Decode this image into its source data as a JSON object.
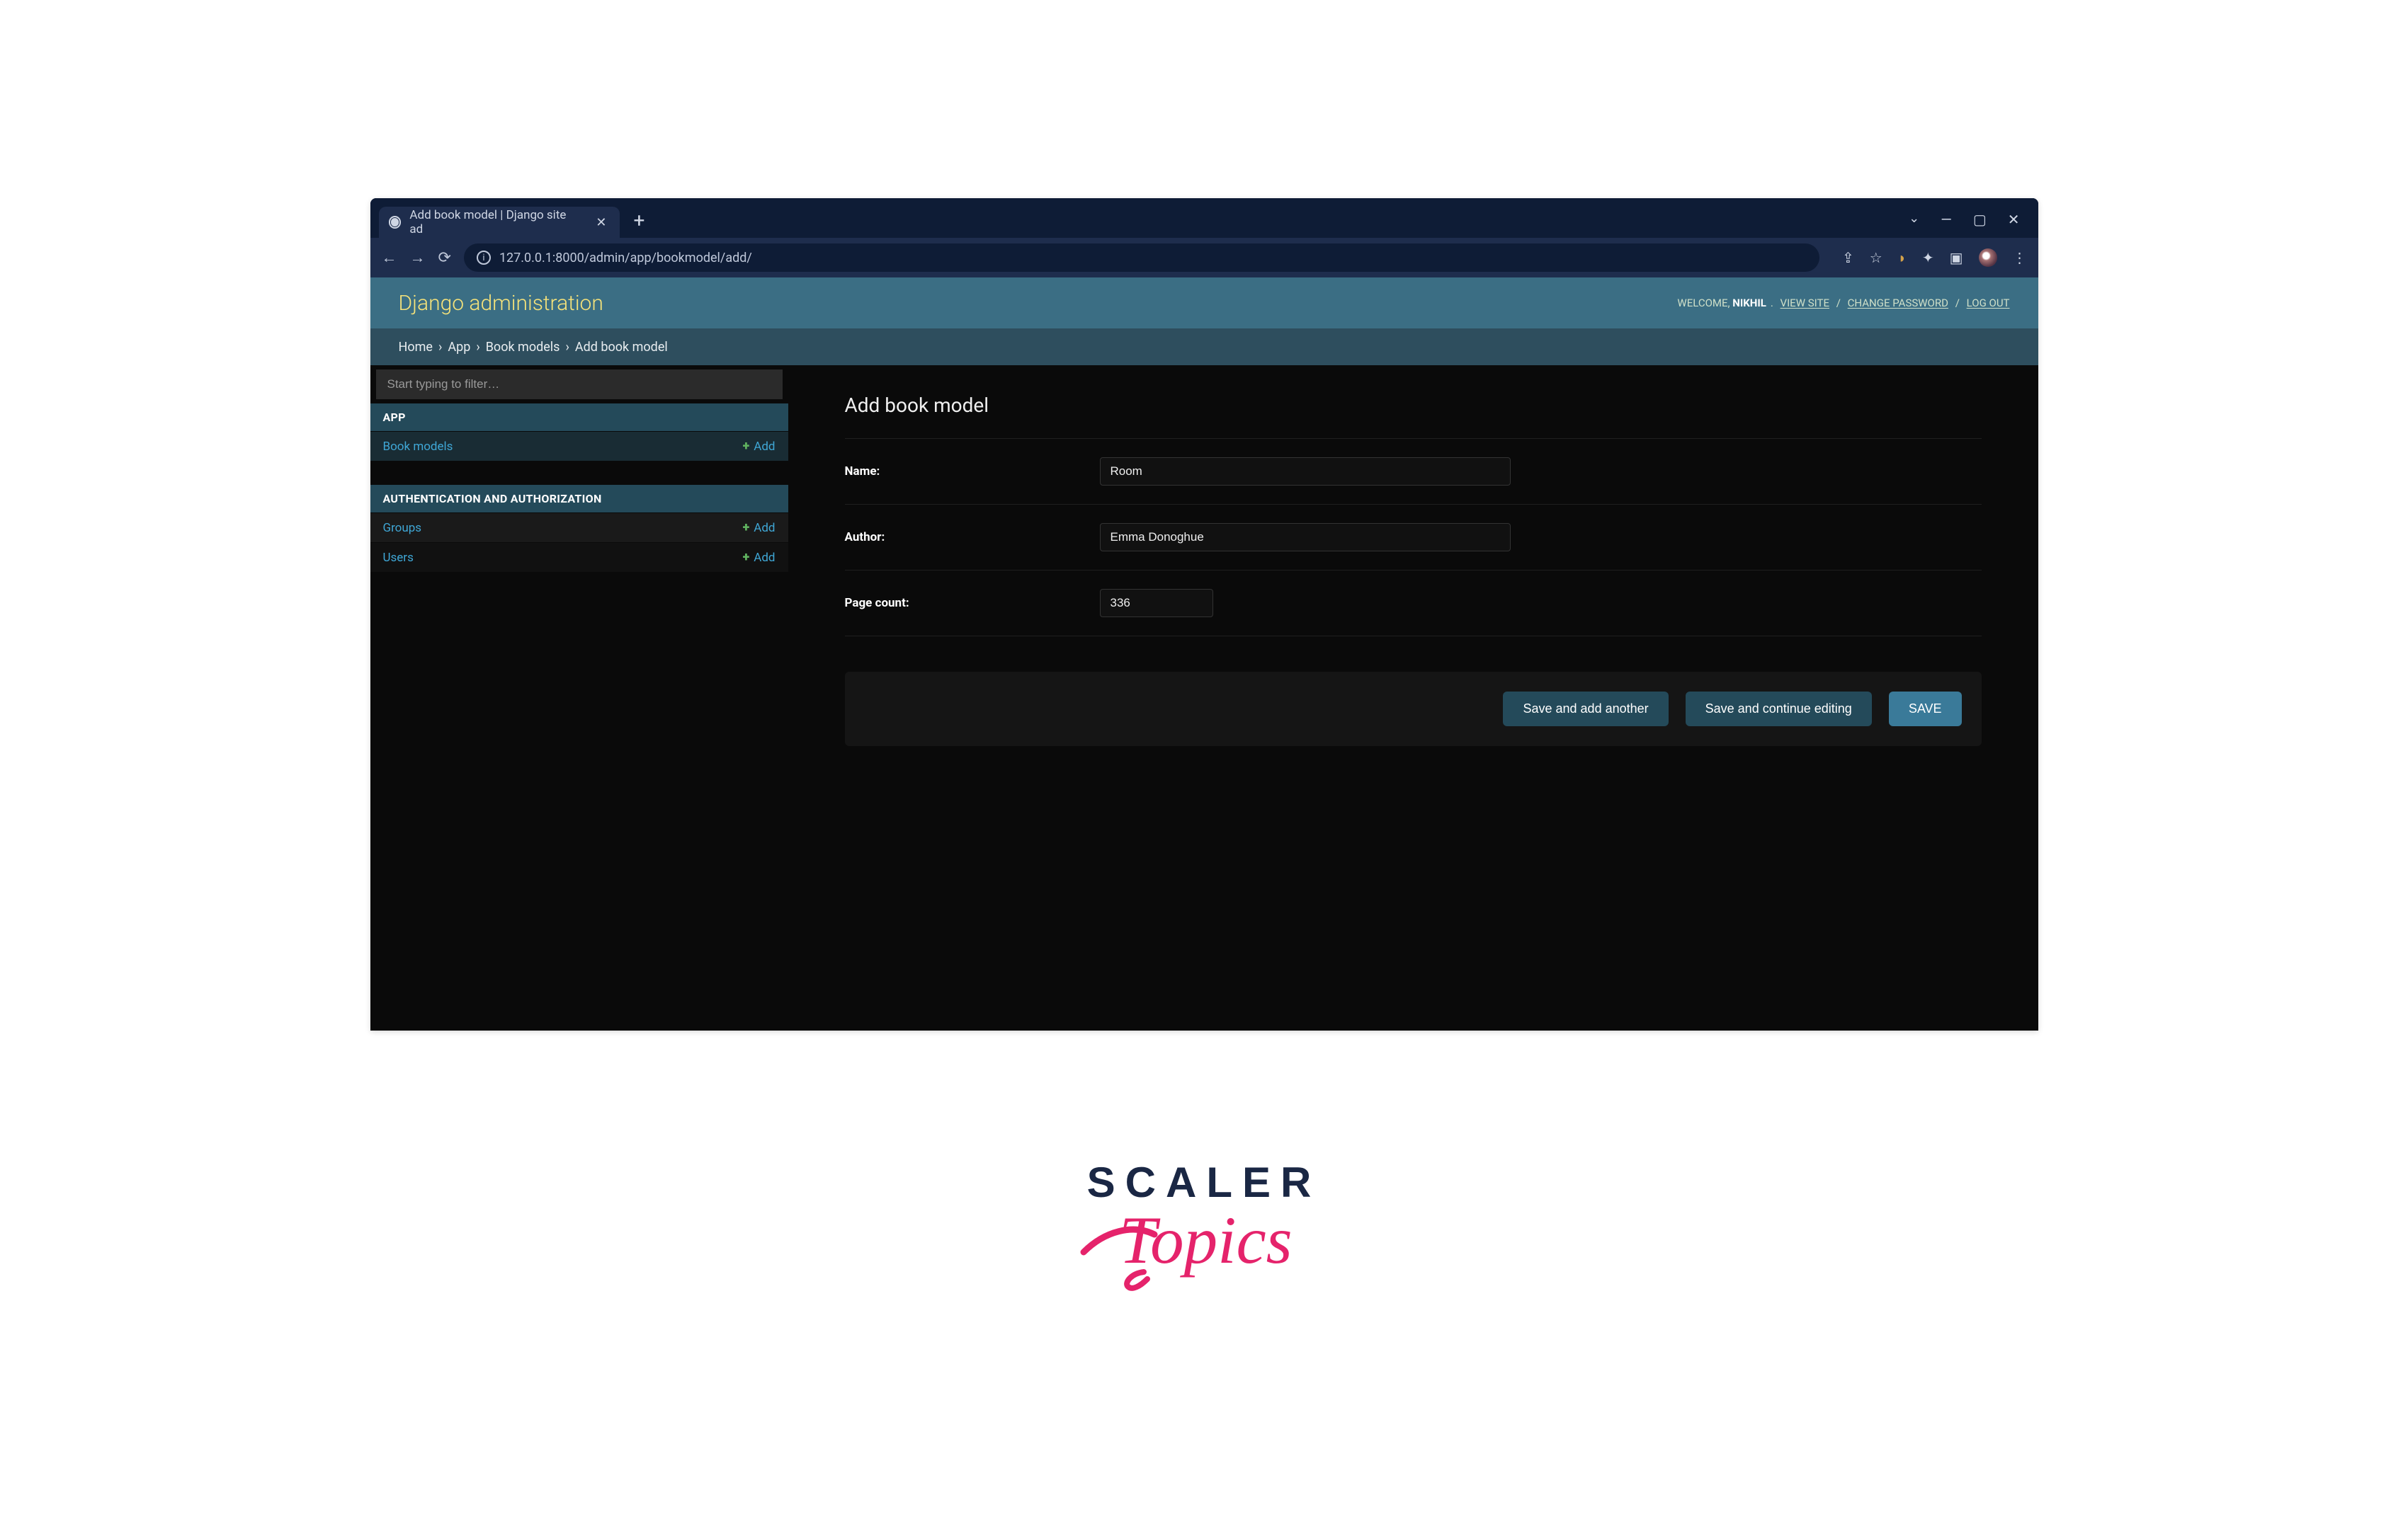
{
  "browser": {
    "tab_title": "Add book model | Django site ad",
    "url": "127.0.0.1:8000/admin/app/bookmodel/add/"
  },
  "header": {
    "title": "Django administration",
    "welcome": "WELCOME,",
    "username": "NIKHIL",
    "view_site": "VIEW SITE",
    "change_password": "CHANGE PASSWORD",
    "logout": "LOG OUT"
  },
  "breadcrumbs": {
    "home": "Home",
    "app": "App",
    "model": "Book models",
    "current": "Add book model"
  },
  "sidebar": {
    "filter_placeholder": "Start typing to filter…",
    "apps": [
      {
        "caption": "APP",
        "models": [
          {
            "label": "Book models",
            "add": "Add"
          }
        ]
      },
      {
        "caption": "AUTHENTICATION AND AUTHORIZATION",
        "models": [
          {
            "label": "Groups",
            "add": "Add"
          },
          {
            "label": "Users",
            "add": "Add"
          }
        ]
      }
    ]
  },
  "main": {
    "page_title": "Add book model",
    "fields": {
      "name": {
        "label": "Name:",
        "value": "Room"
      },
      "author": {
        "label": "Author:",
        "value": "Emma Donoghue"
      },
      "page_count": {
        "label": "Page count:",
        "value": "336"
      }
    },
    "buttons": {
      "save_add_another": "Save and add another",
      "save_continue": "Save and continue editing",
      "save": "SAVE"
    }
  },
  "logo": {
    "line1": "SCALER",
    "line2": "Topics"
  }
}
